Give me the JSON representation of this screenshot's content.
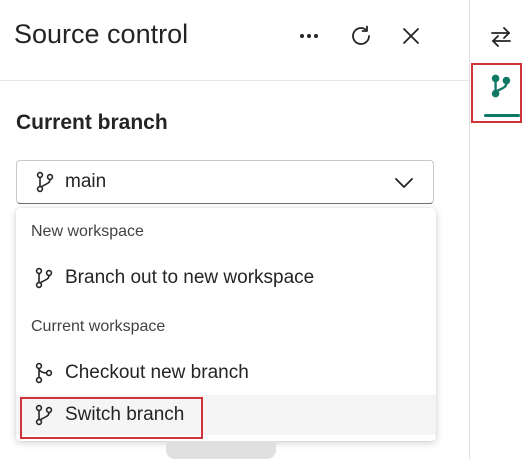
{
  "panel": {
    "title": "Source control",
    "header_icons": [
      "more-icon",
      "refresh-icon",
      "close-icon"
    ]
  },
  "current_branch": {
    "heading": "Current branch",
    "selected": "main"
  },
  "menu": {
    "group1_label": "New workspace",
    "branch_out_label": "Branch out to new workspace",
    "group2_label": "Current workspace",
    "checkout_label": "Checkout new branch",
    "switch_label": "Switch branch"
  },
  "rail": {
    "icons": [
      "swap-arrows-icon",
      "branch-icon"
    ],
    "active": "branch-icon"
  },
  "colors": {
    "accent": "#117865",
    "highlight": "#d13438",
    "text": "#242424"
  }
}
